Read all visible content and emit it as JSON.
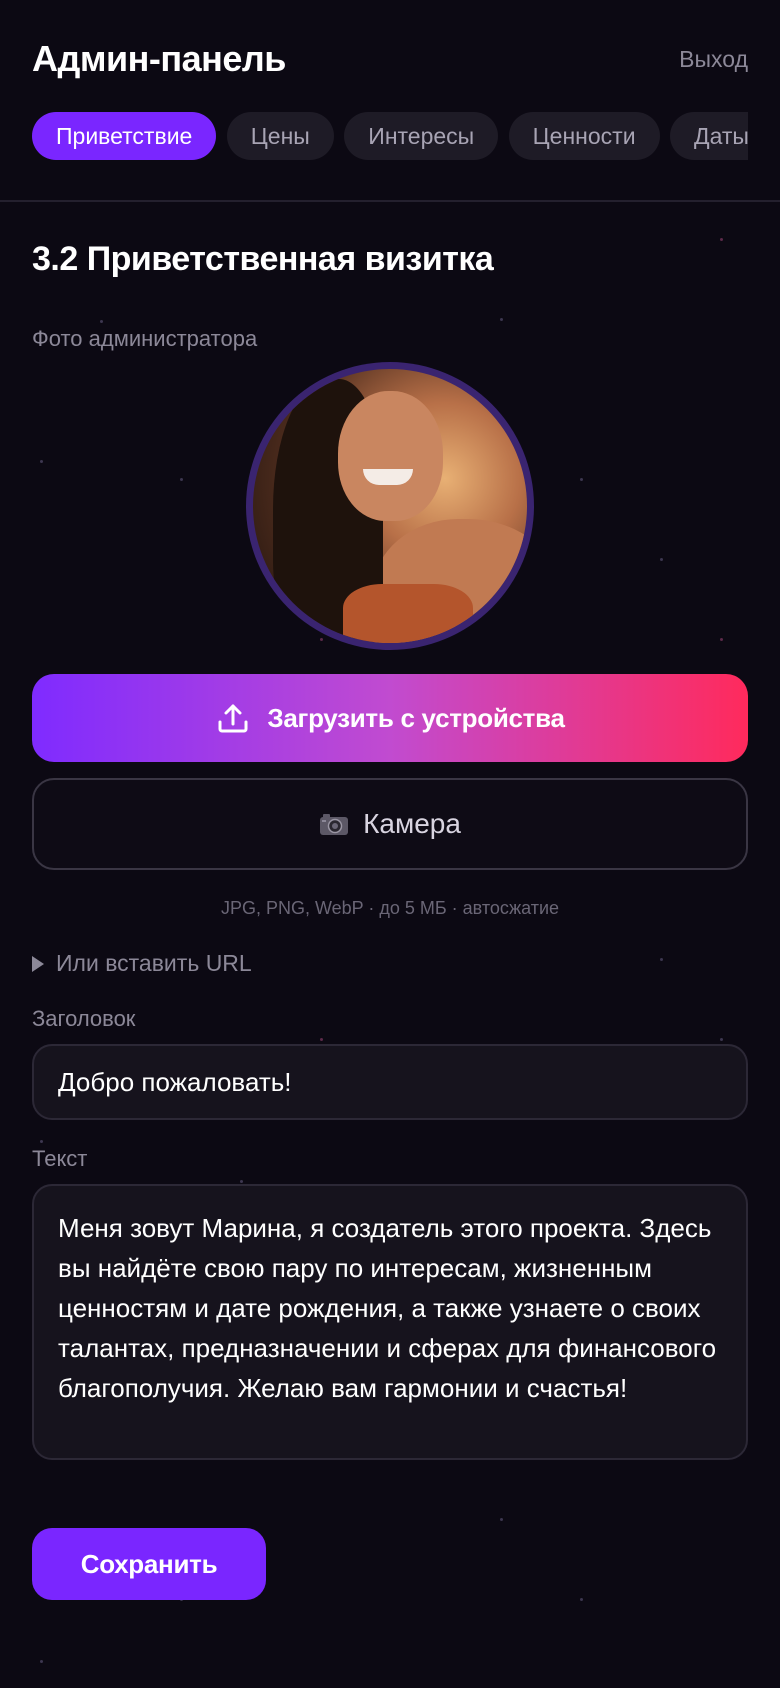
{
  "header": {
    "title": "Админ-панель",
    "logout_label": "Выход"
  },
  "tabs": [
    {
      "label": "Приветствие",
      "active": true
    },
    {
      "label": "Цены",
      "active": false
    },
    {
      "label": "Интересы",
      "active": false
    },
    {
      "label": "Ценности",
      "active": false
    },
    {
      "label": "Даты",
      "active": false
    }
  ],
  "section": {
    "title": "3.2 Приветственная визитка"
  },
  "photo": {
    "label": "Фото администратора",
    "upload_label": "Загрузить с устройства",
    "upload_icon": "upload-icon",
    "camera_label": "Камера",
    "camera_icon": "camera-icon",
    "hint": "JPG, PNG, WebP · до 5 МБ · автосжатие",
    "url_toggle_label": "Или вставить URL"
  },
  "heading_field": {
    "label": "Заголовок",
    "value": "Добро пожаловать!"
  },
  "text_field": {
    "label": "Текст",
    "value": "Меня зовут Марина, я создатель этого проекта. Здесь вы найдёте свою пару по интересам, жизненным ценностям и дате рождения, а также узнаете о своих талантах, предназначении и сферах для финансового благополучия. Желаю вам гармонии и счастья!"
  },
  "save_label": "Сохранить",
  "colors": {
    "background": "#0c0913",
    "accent": "#7a26ff",
    "gradient_start": "#7f2bff",
    "gradient_end": "#ff2a5c"
  }
}
